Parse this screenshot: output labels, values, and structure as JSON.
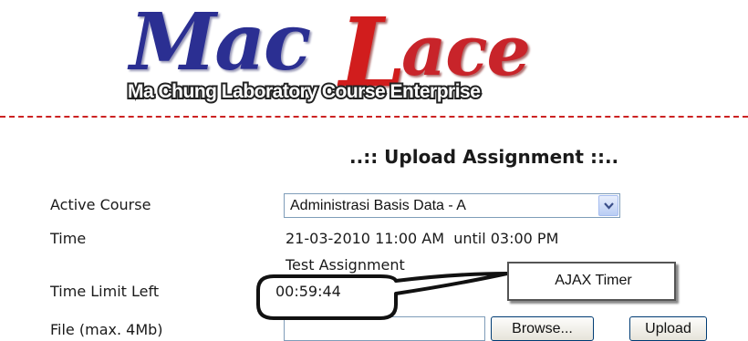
{
  "header": {
    "logo_main": "Mac",
    "logo_l": "L",
    "logo_rest": "ace",
    "logo_subtitle": "Ma Chung Laboratory Course Enterprise"
  },
  "page_title": "..:: Upload Assignment ::..",
  "form": {
    "active_course_label": "Active Course",
    "active_course_value": "Administrasi Basis Data - A",
    "time_label": "Time",
    "time_value": "21-03-2010 11:00 AM  until 03:00 PM",
    "assignment_name": "Test Assignment",
    "time_limit_label": "Time Limit Left",
    "time_limit_value": "00:59:44",
    "file_label": "File (max. 4Mb)",
    "browse_label": "Browse...",
    "upload_label": "Upload"
  },
  "callout": {
    "text": "AJAX Timer"
  },
  "colors": {
    "logo_blue": "#2b2f92",
    "logo_red": "#c8242a",
    "divider": "#cc2222"
  }
}
